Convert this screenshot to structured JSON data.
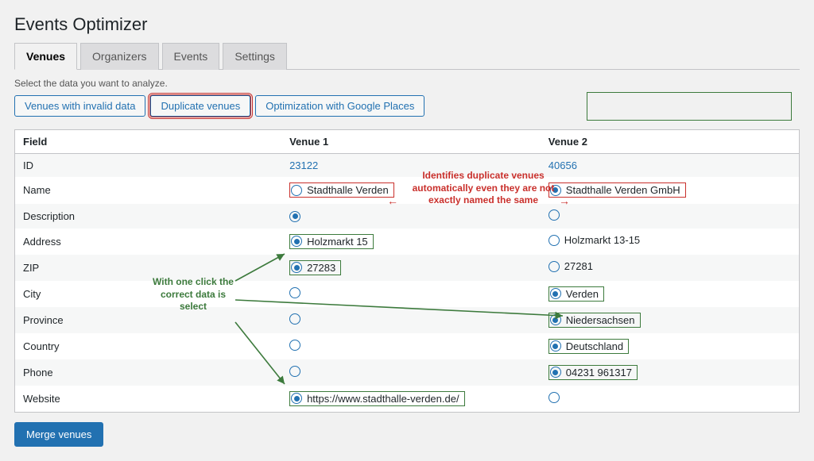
{
  "pageTitle": "Events Optimizer",
  "tabs": [
    {
      "label": "Venues",
      "active": true
    },
    {
      "label": "Organizers",
      "active": false
    },
    {
      "label": "Events",
      "active": false
    },
    {
      "label": "Settings",
      "active": false
    }
  ],
  "instructions": "Select the data you want to analyze.",
  "actionButtons": [
    {
      "label": "Venues with invalid data",
      "highlighted": false
    },
    {
      "label": "Duplicate venues",
      "highlighted": true
    },
    {
      "label": "Optimization with Google Places",
      "highlighted": false
    }
  ],
  "tableHeaders": {
    "field": "Field",
    "v1": "Venue 1",
    "v2": "Venue 2"
  },
  "rows": [
    {
      "field": "ID",
      "v1": {
        "text": "23122",
        "link": true,
        "selected": false,
        "radio": false
      },
      "v2": {
        "text": "40656",
        "link": true,
        "selected": false,
        "radio": false
      }
    },
    {
      "field": "Name",
      "v1": {
        "text": "Stadthalle Verden",
        "selected": false,
        "radio": true,
        "anno": "red"
      },
      "v2": {
        "text": "Stadthalle Verden GmbH",
        "selected": true,
        "radio": true,
        "anno": "red"
      }
    },
    {
      "field": "Description",
      "v1": {
        "text": "",
        "selected": true,
        "radio": true
      },
      "v2": {
        "text": "",
        "selected": false,
        "radio": true
      }
    },
    {
      "field": "Address",
      "v1": {
        "text": "Holzmarkt 15",
        "selected": true,
        "radio": true,
        "anno": "green"
      },
      "v2": {
        "text": "Holzmarkt 13-15",
        "selected": false,
        "radio": true
      }
    },
    {
      "field": "ZIP",
      "v1": {
        "text": "27283",
        "selected": true,
        "radio": true,
        "anno": "green"
      },
      "v2": {
        "text": "27281",
        "selected": false,
        "radio": true
      }
    },
    {
      "field": "City",
      "v1": {
        "text": "",
        "selected": false,
        "radio": true
      },
      "v2": {
        "text": "Verden",
        "selected": true,
        "radio": true,
        "anno": "green"
      }
    },
    {
      "field": "Province",
      "v1": {
        "text": "",
        "selected": false,
        "radio": true
      },
      "v2": {
        "text": "Niedersachsen",
        "selected": true,
        "radio": true,
        "anno": "green"
      }
    },
    {
      "field": "Country",
      "v1": {
        "text": "",
        "selected": false,
        "radio": true
      },
      "v2": {
        "text": "Deutschland",
        "selected": true,
        "radio": true,
        "anno": "green"
      }
    },
    {
      "field": "Phone",
      "v1": {
        "text": "",
        "selected": false,
        "radio": true
      },
      "v2": {
        "text": "04231 961317",
        "selected": true,
        "radio": true,
        "anno": "green"
      }
    },
    {
      "field": "Website",
      "v1": {
        "text": "https://www.stadthalle-verden.de/",
        "selected": true,
        "radio": true,
        "anno": "green"
      },
      "v2": {
        "text": "",
        "selected": false,
        "radio": true
      }
    }
  ],
  "mergeButton": "Merge venues",
  "annotations": {
    "redText": "Identifies duplicate venues automatically even they are not exactly named the same",
    "greenText": "With one click the correct data is select"
  }
}
